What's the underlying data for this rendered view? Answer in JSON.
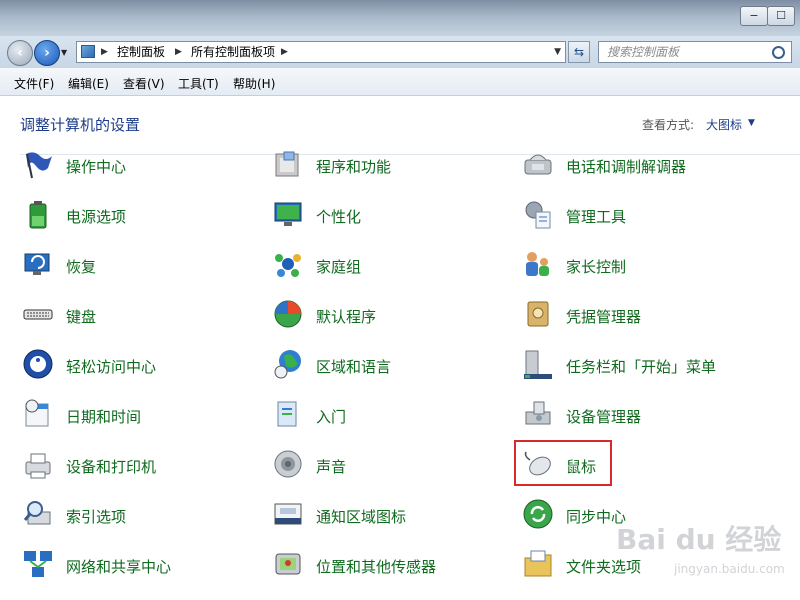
{
  "window": {
    "minimize_glyph": "−",
    "maximize_glyph": "☐"
  },
  "navbar": {
    "breadcrumbs": [
      "控制面板",
      "所有控制面板项"
    ],
    "search_placeholder": "搜索控制面板"
  },
  "menu": [
    "文件(F)",
    "编辑(E)",
    "查看(V)",
    "工具(T)",
    "帮助(H)"
  ],
  "header": {
    "title": "调整计算机的设置",
    "view_by_label": "查看方式:",
    "view_by_value": "大图标"
  },
  "items": [
    {
      "label": "操作中心",
      "icon": "flag-icon"
    },
    {
      "label": "程序和功能",
      "icon": "programs-icon"
    },
    {
      "label": "电话和调制解调器",
      "icon": "phone-modem-icon"
    },
    {
      "label": "电源选项",
      "icon": "battery-icon"
    },
    {
      "label": "个性化",
      "icon": "personalize-icon"
    },
    {
      "label": "管理工具",
      "icon": "admin-tools-icon"
    },
    {
      "label": "恢复",
      "icon": "recovery-icon"
    },
    {
      "label": "家庭组",
      "icon": "homegroup-icon"
    },
    {
      "label": "家长控制",
      "icon": "parental-controls-icon"
    },
    {
      "label": "键盘",
      "icon": "keyboard-icon"
    },
    {
      "label": "默认程序",
      "icon": "default-programs-icon"
    },
    {
      "label": "凭据管理器",
      "icon": "credential-manager-icon"
    },
    {
      "label": "轻松访问中心",
      "icon": "ease-of-access-icon"
    },
    {
      "label": "区域和语言",
      "icon": "globe-icon"
    },
    {
      "label": "任务栏和「开始」菜单",
      "icon": "taskbar-icon"
    },
    {
      "label": "日期和时间",
      "icon": "calendar-clock-icon"
    },
    {
      "label": "入门",
      "icon": "getting-started-icon"
    },
    {
      "label": "设备管理器",
      "icon": "device-manager-icon"
    },
    {
      "label": "设备和打印机",
      "icon": "printer-icon"
    },
    {
      "label": "声音",
      "icon": "speaker-icon"
    },
    {
      "label": "鼠标",
      "icon": "mouse-icon"
    },
    {
      "label": "索引选项",
      "icon": "search-index-icon"
    },
    {
      "label": "通知区域图标",
      "icon": "notification-area-icon"
    },
    {
      "label": "同步中心",
      "icon": "sync-icon"
    },
    {
      "label": "网络和共享中心",
      "icon": "network-icon"
    },
    {
      "label": "位置和其他传感器",
      "icon": "location-sensor-icon"
    },
    {
      "label": "文件夹选项",
      "icon": "folder-options-icon"
    }
  ],
  "highlighted_item": "鼠标",
  "watermark": {
    "name": "Bai du 经验",
    "url": "jingyan.baidu.com"
  }
}
